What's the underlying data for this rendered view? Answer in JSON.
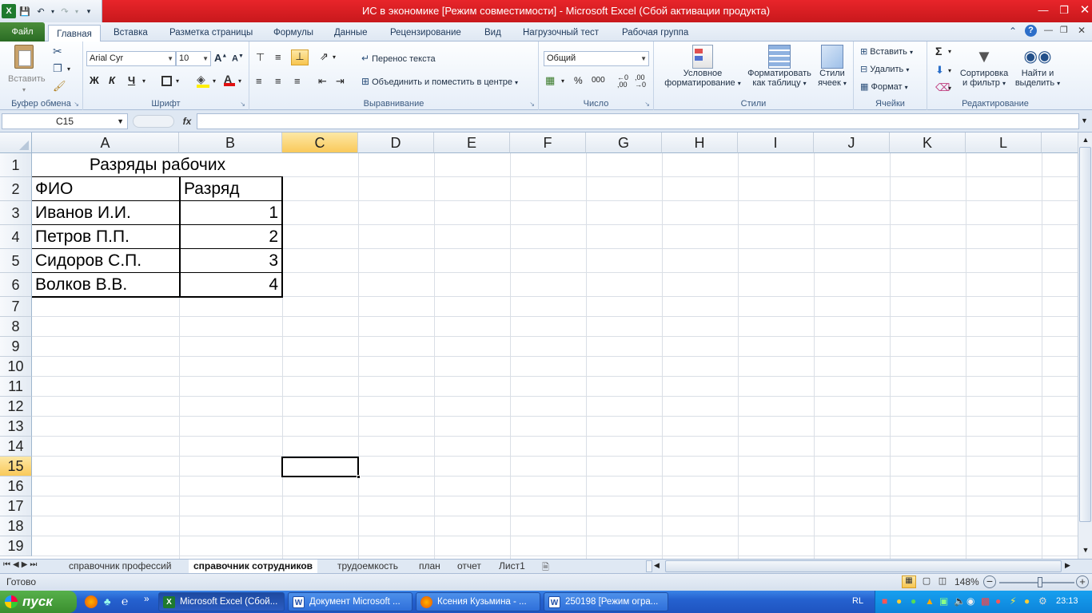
{
  "window": {
    "title": "ИС в экономике  [Режим совместимости]  -  Microsoft Excel (Сбой активации продукта)"
  },
  "ribbon": {
    "tabs": [
      "Файл",
      "Главная",
      "Вставка",
      "Разметка страницы",
      "Формулы",
      "Данные",
      "Рецензирование",
      "Вид",
      "Нагрузочный тест",
      "Рабочая группа"
    ],
    "clipboard": {
      "paste": "Вставить",
      "group": "Буфер обмена"
    },
    "font": {
      "name": "Arial Cyr",
      "size": "10",
      "bold": "Ж",
      "italic": "К",
      "underline": "Ч",
      "group": "Шрифт"
    },
    "alignment": {
      "wrap": "Перенос текста",
      "merge": "Объединить и поместить в центре",
      "group": "Выравнивание"
    },
    "number": {
      "format": "Общий",
      "percent": "%",
      "thousands": "000",
      "group": "Число"
    },
    "styles": {
      "cond_line1": "Условное",
      "cond_line2": "форматирование",
      "table_line1": "Форматировать",
      "table_line2": "как таблицу",
      "cell_line1": "Стили",
      "cell_line2": "ячеек",
      "group": "Стили"
    },
    "cells": {
      "insert": "Вставить",
      "delete": "Удалить",
      "format": "Формат",
      "group": "Ячейки"
    },
    "editing": {
      "sum": "Σ",
      "sort_line1": "Сортировка",
      "sort_line2": "и фильтр",
      "find_line1": "Найти и",
      "find_line2": "выделить",
      "group": "Редактирование"
    }
  },
  "formula_bar": {
    "name_box": "C15",
    "fx": "fx",
    "value": ""
  },
  "sheet": {
    "columns": [
      "A",
      "B",
      "C",
      "D",
      "E",
      "F",
      "G",
      "H",
      "I",
      "J",
      "K",
      "L"
    ],
    "rows": [
      "1",
      "2",
      "3",
      "4",
      "5",
      "6",
      "7",
      "8",
      "9",
      "10",
      "11",
      "12",
      "13",
      "14",
      "15",
      "16",
      "17",
      "18",
      "19"
    ],
    "title": "Разряды рабочих",
    "headers": {
      "name": "ФИО",
      "rank": "Разряд"
    },
    "records": [
      {
        "name": "Иванов И.И.",
        "rank": "1"
      },
      {
        "name": "Петров П.П.",
        "rank": "2"
      },
      {
        "name": "Сидоров С.П.",
        "rank": "3"
      },
      {
        "name": "Волков В.В.",
        "rank": "4"
      }
    ]
  },
  "sheet_tabs": [
    "справочник профессий",
    "справочник сотрудников",
    "трудоемкость",
    "план",
    "отчет",
    "Лист1"
  ],
  "status": {
    "ready": "Готово",
    "zoom": "148%"
  },
  "taskbar": {
    "start": "пуск",
    "tasks": [
      "Microsoft Excel (Сбой...",
      "Документ Microsoft ...",
      "Ксения Кузьмина - ...",
      "250198 [Режим огра..."
    ],
    "lang": "RL",
    "clock": "23:13"
  }
}
